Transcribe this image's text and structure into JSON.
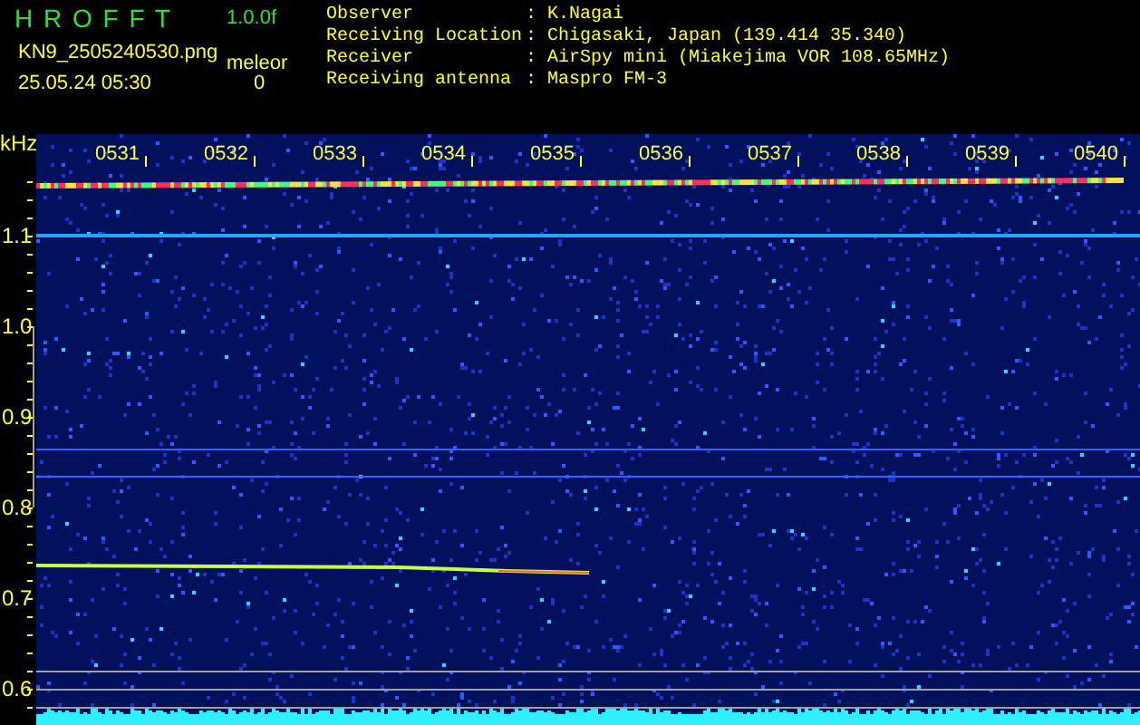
{
  "app": {
    "title": "H R O F F T",
    "version": "1.0.0f",
    "filename": "KN9_2505240530.png",
    "timestamp": "25.05.24 05:30",
    "counter_label": "meleor",
    "counter_value": "0"
  },
  "info": [
    {
      "label": "Observer",
      "separator": ":",
      "value": "K.Nagai"
    },
    {
      "label": "Receiving Location",
      "separator": ":",
      "value": "Chigasaki, Japan (139.414 35.340)"
    },
    {
      "label": "Receiver",
      "separator": ":",
      "value": "AirSpy mini (Miakejima VOR 108.65MHz)"
    },
    {
      "label": "Receiving antenna",
      "separator": ":",
      "value": "Maspro FM-3"
    }
  ],
  "spectrogram": {
    "y_unit": "kHz",
    "y_labels": [
      "1.1",
      "1.0",
      "0.9",
      "0.8",
      "0.7",
      "0.6"
    ],
    "time_labels": [
      "0531",
      "0532",
      "0533",
      "0534",
      "0535",
      "0536",
      "0537",
      "0538",
      "0539",
      "0540"
    ]
  }
}
